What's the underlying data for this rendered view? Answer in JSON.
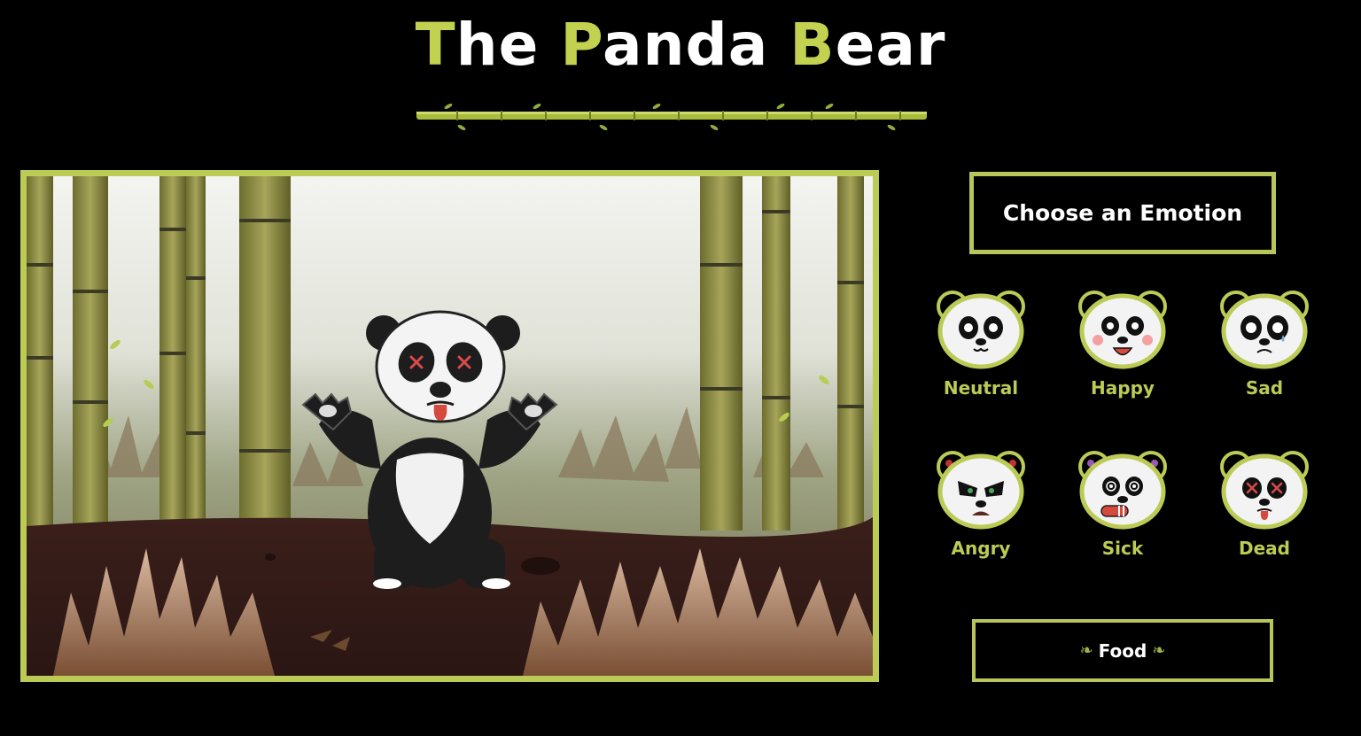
{
  "title": {
    "part1_cap": "T",
    "part1_rest": "he",
    "part2_cap": "P",
    "part2_rest": "anda",
    "part3_cap": "B",
    "part3_rest": "ear"
  },
  "panel": {
    "choose_label": "Choose an Emotion",
    "emotions": [
      {
        "label": "Neutral"
      },
      {
        "label": "Happy"
      },
      {
        "label": "Sad"
      },
      {
        "label": "Angry"
      },
      {
        "label": "Sick"
      },
      {
        "label": "Dead"
      }
    ],
    "food_label": "Food"
  },
  "scene": {
    "current_emotion": "Dead"
  },
  "colors": {
    "accent": "#bccb55",
    "background": "#000000"
  },
  "icons": {
    "food_leaf": "bamboo-leaf-icon"
  }
}
